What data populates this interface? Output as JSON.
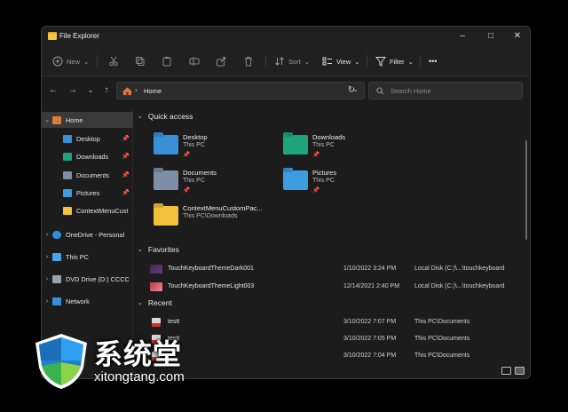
{
  "window": {
    "title": "File Explorer"
  },
  "toolbar": {
    "new_label": "New",
    "sort_label": "Sort",
    "view_label": "View",
    "filter_label": "Filter",
    "more_label": "•••"
  },
  "address": {
    "path": "Home"
  },
  "search": {
    "placeholder": "Search Home"
  },
  "sidebar": {
    "items": [
      {
        "label": "Home"
      },
      {
        "label": "Desktop"
      },
      {
        "label": "Downloads"
      },
      {
        "label": "Documents"
      },
      {
        "label": "Pictures"
      },
      {
        "label": "ContextMenuCust"
      },
      {
        "label": "OneDrive - Personal"
      },
      {
        "label": "This PC"
      },
      {
        "label": "DVD Drive (D:) CCCC"
      },
      {
        "label": "Network"
      }
    ]
  },
  "quick_access": {
    "title": "Quick access",
    "items": [
      {
        "name": "Desktop",
        "sub": "This PC",
        "color": "#3b8fd8"
      },
      {
        "name": "Downloads",
        "sub": "This PC",
        "color": "#1fa37a"
      },
      {
        "name": "Documents",
        "sub": "This PC",
        "color": "#7c8fa6"
      },
      {
        "name": "Pictures",
        "sub": "This PC",
        "color": "#3c9ee0"
      },
      {
        "name": "ContextMenuCustomPac...",
        "sub": "This PC\\Downloads",
        "color": "#f3c13a"
      }
    ]
  },
  "favorites": {
    "title": "Favorites",
    "rows": [
      {
        "name": "TouchKeyboardThemeDark001",
        "date": "1/10/2022 3:24 PM",
        "location": "Local Disk (C:)\\...\\touchkeyboard"
      },
      {
        "name": "TouchKeyboardThemeLight003",
        "date": "12/14/2021 2:40 PM",
        "location": "Local Disk (C:)\\...\\touchkeyboard"
      }
    ]
  },
  "recent": {
    "title": "Recent",
    "rows": [
      {
        "name": "testt",
        "date": "3/10/2022 7:07 PM",
        "location": "This PC\\Documents"
      },
      {
        "name": "testt",
        "date": "3/10/2022 7:05 PM",
        "location": "This PC\\Documents"
      },
      {
        "name": "",
        "date": "3/10/2022 7:04 PM",
        "location": "This PC\\Documents"
      }
    ]
  },
  "watermark": {
    "text": "系统堂",
    "url": "xitongtang.com"
  }
}
